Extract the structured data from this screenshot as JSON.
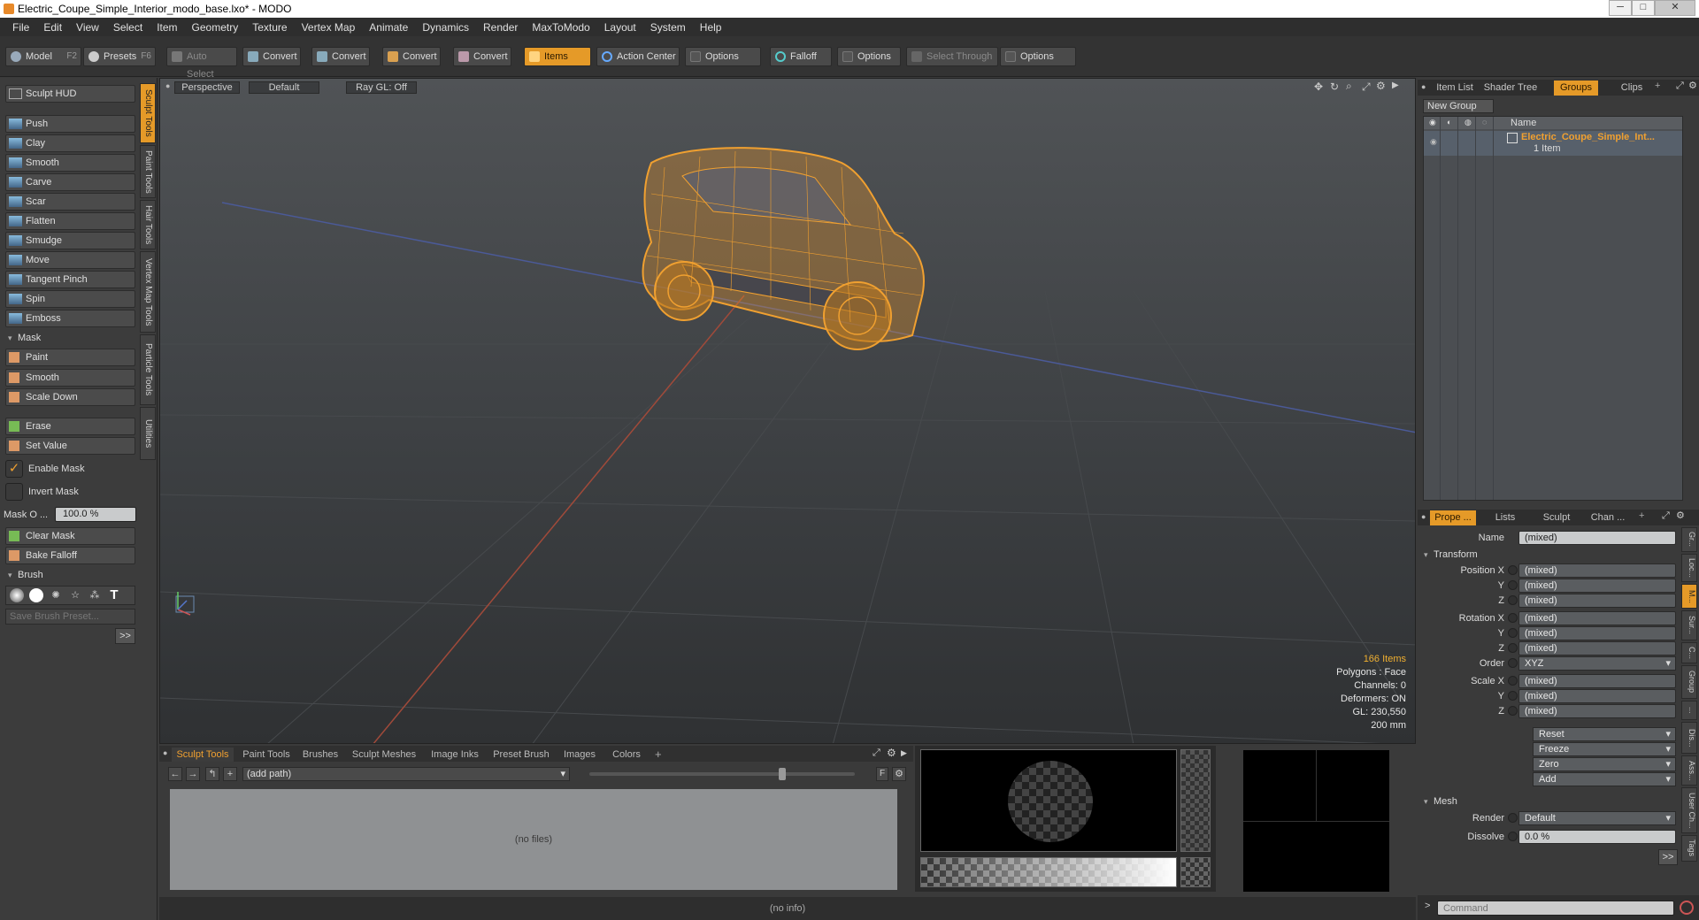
{
  "window": {
    "title": "Electric_Coupe_Simple_Interior_modo_base.lxo* - MODO"
  },
  "menu": [
    "File",
    "Edit",
    "View",
    "Select",
    "Item",
    "Geometry",
    "Texture",
    "Vertex Map",
    "Animate",
    "Dynamics",
    "Render",
    "MaxToModo",
    "Layout",
    "System",
    "Help"
  ],
  "toolbar": {
    "model": "Model",
    "model_key": "F2",
    "presets": "Presets",
    "presets_key": "F6",
    "auto_select": "Auto Select",
    "convert1": "Convert",
    "convert2": "Convert",
    "convert3": "Convert",
    "convert4": "Convert",
    "items": "Items",
    "action_center": "Action Center",
    "options1": "Options",
    "falloff": "Falloff",
    "options2": "Options",
    "select_through": "Select Through",
    "options3": "Options"
  },
  "sculpt": {
    "hud": "Sculpt HUD",
    "tools": [
      "Push",
      "Clay",
      "Smooth",
      "Carve",
      "Scar",
      "Flatten",
      "Smudge",
      "Move",
      "Tangent Pinch",
      "Spin",
      "Emboss"
    ],
    "mask_header": "Mask",
    "mask_tools": [
      "Paint",
      "Smooth",
      "Scale Down"
    ],
    "erase": "Erase",
    "set_value": "Set Value",
    "enable_mask": "Enable Mask",
    "invert_mask": "Invert Mask",
    "mask_opacity_label": "Mask O ...",
    "mask_opacity_value": "100.0 %",
    "clear_mask": "Clear Mask",
    "bake_falloff": "Bake Falloff",
    "brush_header": "Brush",
    "save_brush": "Save Brush Preset...",
    "more": ">>"
  },
  "vtabs": [
    "Sculpt Tools",
    "Paint Tools",
    "Hair Tools",
    "Vertex Map Tools",
    "Particle Tools",
    "Utilities"
  ],
  "viewport": {
    "view": "Perspective",
    "shading": "Default",
    "raygl": "Ray GL: Off",
    "info": {
      "items": "166 Items",
      "polygons": "Polygons : Face",
      "channels": "Channels: 0",
      "deformers": "Deformers: ON",
      "gl": "GL: 230,550",
      "scale": "200 mm"
    }
  },
  "bottom": {
    "tabs": [
      "Sculpt Tools",
      "Paint Tools",
      "Brushes",
      "Sculpt Meshes",
      "Image Inks",
      "Preset Brush",
      "Images",
      "Colors"
    ],
    "path": "(add path)",
    "no_files": "(no files)",
    "status": "(no info)"
  },
  "right": {
    "top_tabs": [
      "Item List",
      "Shader Tree",
      "Groups",
      "Clips"
    ],
    "new_group": "New Group",
    "name_header": "Name",
    "group_name": "Electric_Coupe_Simple_Int...",
    "group_count": "1 Item",
    "prop_tabs": [
      "Prope ...",
      "Lists",
      "Sculpt",
      "Chan ..."
    ],
    "name_label": "Name",
    "name_value": "(mixed)",
    "transform_header": "Transform",
    "position_x": "Position X",
    "y": "Y",
    "z": "Z",
    "rotation_x": "Rotation X",
    "order_label": "Order",
    "order_value": "XYZ",
    "scale_x": "Scale X",
    "mixed": "(mixed)",
    "reset": "Reset",
    "freeze": "Freeze",
    "zero": "Zero",
    "add": "Add",
    "mesh_header": "Mesh",
    "render_label": "Render",
    "render_value": "Default",
    "dissolve_label": "Dissolve",
    "dissolve_value": "0.0 %",
    "more": ">>",
    "side_tabs": [
      "Gr...",
      "Loc...",
      "M...",
      "Sur...",
      "C...",
      "Group",
      "...",
      "Dis...",
      "Ass...",
      "User Ch...",
      "Tags"
    ],
    "command_placeholder": "Command"
  },
  "colors": {
    "accent": "#e59a28",
    "wire": "#f0a030"
  }
}
